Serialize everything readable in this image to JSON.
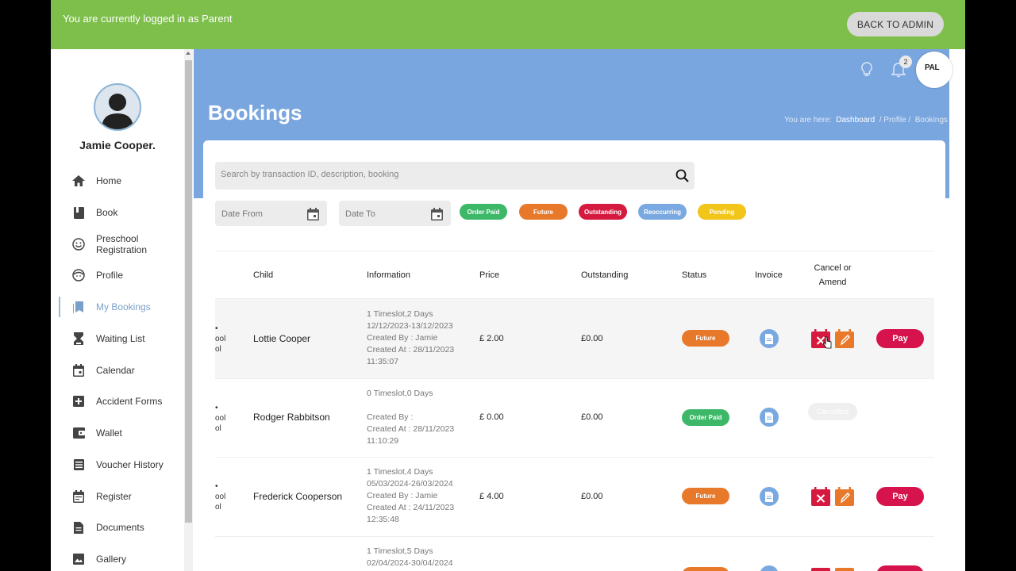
{
  "topbar": {
    "login_message": "You are currently logged in as Parent",
    "back_label": "BACK TO ADMIN"
  },
  "user": {
    "name": "Jamie Cooper."
  },
  "sidebar": {
    "items": [
      {
        "label": "Home",
        "icon": "home-icon"
      },
      {
        "label": "Book",
        "icon": "book-icon"
      },
      {
        "label": "Preschool Registration",
        "icon": "smiley-icon"
      },
      {
        "label": "Profile",
        "icon": "face-icon"
      },
      {
        "label": "My Bookings",
        "icon": "bookmarks-icon",
        "active": true
      },
      {
        "label": "Waiting List",
        "icon": "hourglass-icon"
      },
      {
        "label": "Calendar",
        "icon": "calendar-icon"
      },
      {
        "label": "Accident Forms",
        "icon": "plus-box-icon"
      },
      {
        "label": "Wallet",
        "icon": "wallet-icon"
      },
      {
        "label": "Voucher History",
        "icon": "list-icon"
      },
      {
        "label": "Register",
        "icon": "calendar-check-icon"
      },
      {
        "label": "Documents",
        "icon": "document-icon"
      },
      {
        "label": "Gallery",
        "icon": "image-icon"
      }
    ]
  },
  "header": {
    "title": "Bookings",
    "breadcrumb": {
      "prefix": "You are here:",
      "items": [
        "Dashboard",
        "/ Profile /",
        "Bookings"
      ]
    },
    "notification_count": "2",
    "logo_text": "PAL"
  },
  "search": {
    "placeholder": "Search by transaction ID, description, booking"
  },
  "filters": {
    "date_from": "Date From",
    "date_to": "Date To",
    "chips": [
      {
        "label": "Order Paid",
        "color": "#3cb868"
      },
      {
        "label": "Future",
        "color": "#e8792b"
      },
      {
        "label": "Outstanding",
        "color": "#d6193f"
      },
      {
        "label": "Reoccurring",
        "color": "#79a9e0"
      },
      {
        "label": "Pending",
        "color": "#f2c51a"
      }
    ]
  },
  "table": {
    "headers": {
      "child": "Child",
      "information": "Information",
      "price": "Price",
      "outstanding": "Outstanding",
      "status": "Status",
      "invoice": "Invoice",
      "cancel_line1": "Cancel or",
      "cancel_line2": "Amend"
    },
    "rows": [
      {
        "frag": [
          "•",
          "ool",
          "ol"
        ],
        "child": "Lottie Cooper",
        "info": [
          "1 Timeslot,2 Days",
          "12/12/2023-13/12/2023",
          "Created By : Jamie",
          "Created At : 28/11/2023",
          "11:35:07"
        ],
        "price": "£ 2.00",
        "outstanding": "£0.00",
        "status": "Future",
        "status_color": "#e8792b",
        "pay_label": "Pay"
      },
      {
        "frag": [
          "•",
          "ool",
          "ol"
        ],
        "child": "Rodger Rabbitson",
        "info": [
          "0 Timeslot,0 Days",
          "",
          "Created By :",
          "Created At : 28/11/2023",
          "11:10:29"
        ],
        "price": "£ 0.00",
        "outstanding": "£0.00",
        "status": "Order Paid",
        "status_color": "#3cb868",
        "cancelled_label": "Cancelled"
      },
      {
        "frag": [
          "•",
          "ool",
          "ol"
        ],
        "child": "Frederick Cooperson",
        "info": [
          "1 Timeslot,4 Days",
          "05/03/2024-26/03/2024",
          "Created By : Jamie",
          "Created At : 24/11/2023",
          "12:35:48"
        ],
        "price": "£ 4.00",
        "outstanding": "£0.00",
        "status": "Future",
        "status_color": "#e8792b",
        "pay_label": "Pay"
      },
      {
        "info": [
          "1 Timeslot,5 Days",
          "02/04/2024-30/04/2024"
        ]
      }
    ]
  }
}
